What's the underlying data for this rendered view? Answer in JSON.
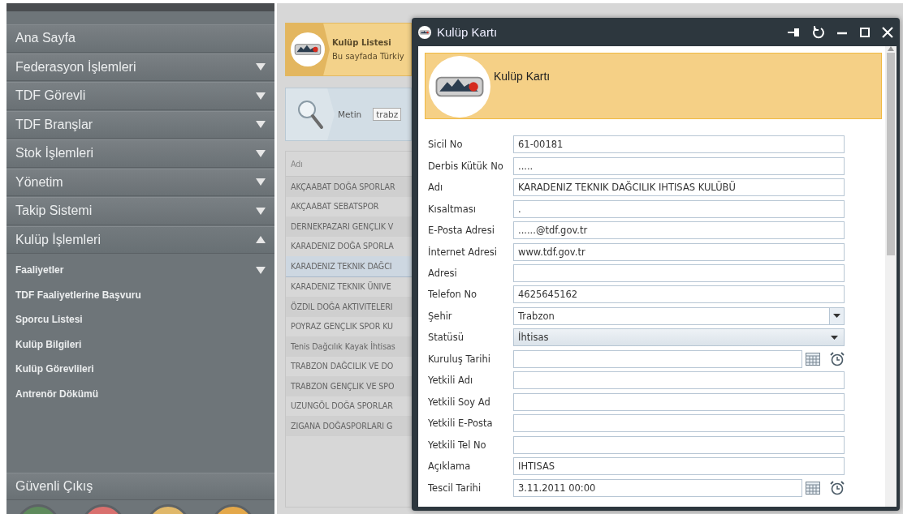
{
  "sidebar": {
    "items": [
      {
        "label": "Ana Sayfa",
        "has_children": false
      },
      {
        "label": "Federasyon İşlemleri",
        "has_children": true,
        "expanded": false
      },
      {
        "label": "TDF Görevli",
        "has_children": true,
        "expanded": false
      },
      {
        "label": "TDF Branşlar",
        "has_children": true,
        "expanded": false
      },
      {
        "label": "Stok İşlemleri",
        "has_children": true,
        "expanded": false
      },
      {
        "label": "Yönetim",
        "has_children": true,
        "expanded": false
      },
      {
        "label": "Takip Sistemi",
        "has_children": true,
        "expanded": false
      },
      {
        "label": "Kulüp İşlemleri",
        "has_children": true,
        "expanded": true,
        "children": [
          {
            "label": "Faaliyetler",
            "has_children": true
          },
          {
            "label": "TDF Faaliyetlerine Başvuru",
            "has_children": false
          },
          {
            "label": "Sporcu Listesi",
            "has_children": false
          },
          {
            "label": "Kulüp Bilgileri",
            "has_children": false
          },
          {
            "label": "Kulüp Görevlileri",
            "has_children": false
          },
          {
            "label": "Antrenör Dökümü",
            "has_children": false
          }
        ]
      }
    ],
    "logout": "Güvenli Çıkış",
    "bottom_buttons": [
      {
        "color": "#5e8a5c"
      },
      {
        "color": "#d9706e"
      },
      {
        "color": "#e0b86a"
      },
      {
        "color": "#e4a84a"
      }
    ]
  },
  "page_header": {
    "title": "Kulüp Listesi",
    "subtitle": "Bu sayfada Türkiy"
  },
  "search": {
    "label": "Metin",
    "value": "trabz"
  },
  "table": {
    "columns": [
      "Adı"
    ],
    "rows": [
      {
        "name": "AKÇAABAT DOĞA SPORLAR",
        "selected": false
      },
      {
        "name": "AKÇAABAT SEBATSPOR",
        "selected": false
      },
      {
        "name": "DERNEKPAZARI GENÇLIK V",
        "selected": false
      },
      {
        "name": "KARADENIZ DOĞA SPORLA",
        "selected": false
      },
      {
        "name": "KARADENIZ TEKNIK DAĞCI",
        "selected": true
      },
      {
        "name": "KARADENIZ TEKNIK ÜNIVE",
        "selected": false
      },
      {
        "name": "ÖZDIL DOĞA AKTIVITELERI",
        "selected": false
      },
      {
        "name": "POYRAZ GENÇLIK SPOR KU",
        "selected": false
      },
      {
        "name": "Tenis Dağcılık Kayak İhtisas",
        "selected": false
      },
      {
        "name": "TRABZON DAĞCILIK VE DO",
        "selected": false
      },
      {
        "name": "TRABZON GENÇLIK VE SPO",
        "selected": false
      },
      {
        "name": "UZUNGÖL DOĞA SPORLAR",
        "selected": false
      },
      {
        "name": "ZIGANA DOĞASPORLARI G",
        "selected": false
      }
    ]
  },
  "dialog": {
    "title": "Kulüp Kartı",
    "header": "Kulüp Kartı",
    "fields": [
      {
        "label": "Sicil No",
        "kind": "text",
        "value": "61-00181"
      },
      {
        "label": "Derbis Kütük No",
        "kind": "text",
        "value": "....."
      },
      {
        "label": "Adı",
        "kind": "text",
        "value": "KARADENIZ TEKNIK DAĞCILIK IHTISAS KULÜBÜ"
      },
      {
        "label": "Kısaltması",
        "kind": "text",
        "value": "."
      },
      {
        "label": "E-Posta Adresi",
        "kind": "text",
        "value": "......@tdf.gov.tr"
      },
      {
        "label": "İnternet Adresi",
        "kind": "text",
        "value": "www.tdf.gov.tr"
      },
      {
        "label": "Adresi",
        "kind": "text"
      },
      {
        "label": "Telefon No",
        "kind": "text",
        "value": "4625645162"
      },
      {
        "label": "Şehir",
        "kind": "combo",
        "value": "Trabzon"
      },
      {
        "label": "Statüsü",
        "kind": "dropdown",
        "value": "İhtisas"
      },
      {
        "label": "Kuruluş Tarihi",
        "kind": "datetime"
      },
      {
        "label": "Yetkili Adı",
        "kind": "text"
      },
      {
        "label": "Yetkili Soy Ad",
        "kind": "text"
      },
      {
        "label": "Yetkili E-Posta",
        "kind": "text"
      },
      {
        "label": "Yetkili Tel No",
        "kind": "text"
      },
      {
        "label": "Açıklama",
        "kind": "text",
        "value": "IHTISAS"
      },
      {
        "label": "Tescil Tarihi",
        "kind": "datetime",
        "value": "3.11.2011 00:00"
      }
    ]
  }
}
